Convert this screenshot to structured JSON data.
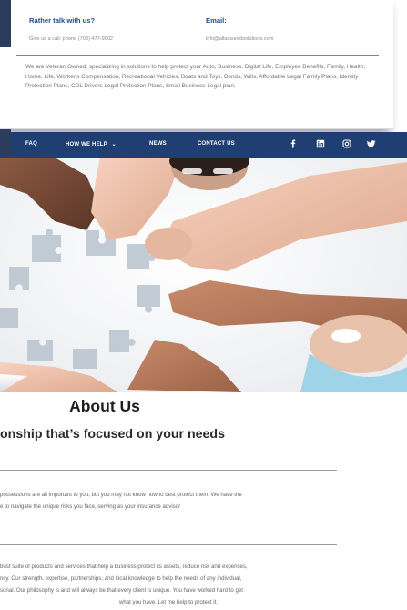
{
  "contact": {
    "talk_title": "Rather talk with us?",
    "talk_sub": "Give us a call: phone (703) 477-9002",
    "email_title": "Email:",
    "email_value": "info@allassuredsolutions.com"
  },
  "intro_text": "We are Veteran Owned, specializing in solutions to help protect your Auto, Business, Digital Life, Employee Benefits, Family, Health, Home, Life, Worker's Compensation, Recreational Vehicles, Boats and Toys. Bonds, Wills, Affordable Legal Family Plans, Identity Protection Plans, CDL Drivers Legal Protection Plans, Small Business Legal plan.",
  "nav": {
    "items": [
      "FAQ",
      "HOW WE HELP",
      "NEWS",
      "CONTACT US"
    ],
    "dropdown_glyph": "⌄",
    "social_icons": [
      "facebook-icon",
      "linkedin-icon",
      "instagram-icon",
      "twitter-icon"
    ],
    "bar_color": "#1f3f73"
  },
  "about": {
    "title": "About Us",
    "subtitle": "onship that’s focused on your needs",
    "para1_line1": "possessions are all important to you, but you may not know how to best protect them. We have the",
    "para1_line2": "e to navigate the unique risks you face, serving as your insurance advisor",
    "para2_line1": "bust suite of products and services that help a business protect its assets, reduce risk and expenses,",
    "para2_line2": "ncy. Our strength, expertise, partnerships, and local knowledge to help the needs of any individual,",
    "para2_line3": "sonal. Our philosophy is and will always be that every client is unique. You have worked hard to get",
    "para2_line4": "what you have. Let me help to protect it."
  },
  "colors": {
    "brand_blue": "#1c4d8c",
    "divider_blue": "#5e89c4"
  }
}
